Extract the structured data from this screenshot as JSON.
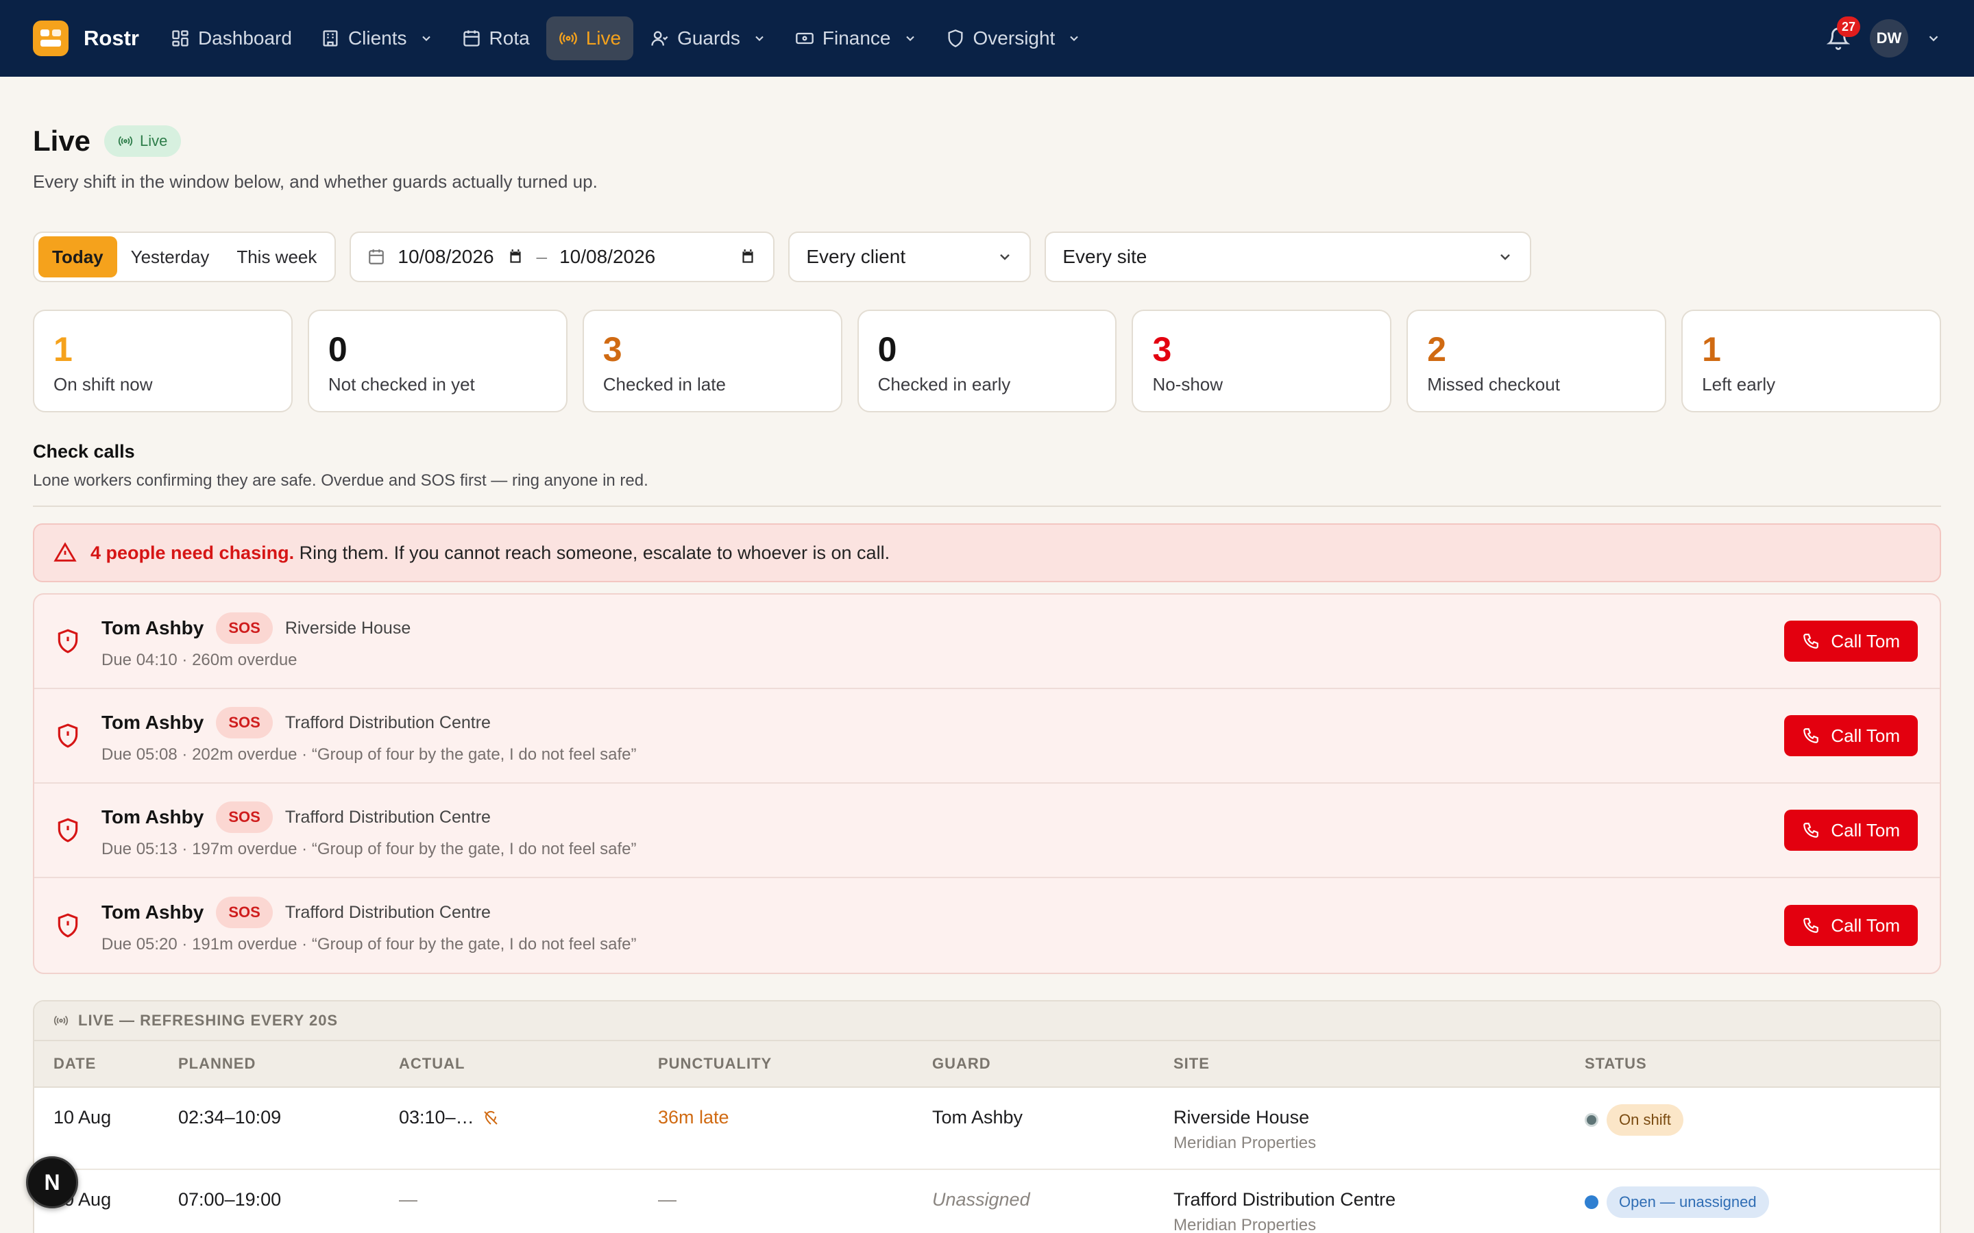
{
  "nav": {
    "brand": "Rostr",
    "items": [
      {
        "label": "Dashboard"
      },
      {
        "label": "Clients"
      },
      {
        "label": "Rota"
      },
      {
        "label": "Live"
      },
      {
        "label": "Guards"
      },
      {
        "label": "Finance"
      },
      {
        "label": "Oversight"
      }
    ],
    "notification_count": "27",
    "avatar_initials": "DW"
  },
  "header": {
    "title": "Live",
    "live_badge": "Live",
    "subtitle": "Every shift in the window below, and whether guards actually turned up."
  },
  "filters": {
    "ranges": [
      "Today",
      "Yesterday",
      "This week"
    ],
    "date_from": "10/08/2026",
    "date_to": "10/08/2026",
    "client": "Every client",
    "site": "Every site"
  },
  "stats": [
    {
      "value": "1",
      "label": "On shift now",
      "color": "#f5a21c"
    },
    {
      "value": "0",
      "label": "Not checked in yet",
      "color": "#141414"
    },
    {
      "value": "3",
      "label": "Checked in late",
      "color": "#d06a12"
    },
    {
      "value": "0",
      "label": "Checked in early",
      "color": "#141414"
    },
    {
      "value": "3",
      "label": "No-show",
      "color": "#e3000f"
    },
    {
      "value": "2",
      "label": "Missed checkout",
      "color": "#d06a12"
    },
    {
      "value": "1",
      "label": "Left early",
      "color": "#d06a12"
    }
  ],
  "check_calls": {
    "title": "Check calls",
    "subtitle": "Lone workers confirming they are safe. Overdue and SOS first — ring anyone in red.",
    "alert_strong": "4 people need chasing.",
    "alert_rest": " Ring them. If you cannot reach someone, escalate to whoever is on call.",
    "rows": [
      {
        "name": "Tom Ashby",
        "tag": "SOS",
        "site": "Riverside House",
        "detail": "Due 04:10 · 260m overdue",
        "button": "Call Tom"
      },
      {
        "name": "Tom Ashby",
        "tag": "SOS",
        "site": "Trafford Distribution Centre",
        "detail": "Due 05:08 · 202m overdue · “Group of four by the gate, I do not feel safe”",
        "button": "Call Tom"
      },
      {
        "name": "Tom Ashby",
        "tag": "SOS",
        "site": "Trafford Distribution Centre",
        "detail": "Due 05:13 · 197m overdue · “Group of four by the gate, I do not feel safe”",
        "button": "Call Tom"
      },
      {
        "name": "Tom Ashby",
        "tag": "SOS",
        "site": "Trafford Distribution Centre",
        "detail": "Due 05:20 · 191m overdue · “Group of four by the gate, I do not feel safe”",
        "button": "Call Tom"
      }
    ]
  },
  "table": {
    "caption": "LIVE — REFRESHING EVERY 20S",
    "headers": [
      "DATE",
      "PLANNED",
      "ACTUAL",
      "PUNCTUALITY",
      "GUARD",
      "SITE",
      "STATUS"
    ],
    "rows": [
      {
        "date": "10 Aug",
        "planned": "02:34–10:09",
        "actual": "03:10–…",
        "punctuality": "36m late",
        "guard": "Tom Ashby",
        "site": "Riverside House",
        "client": "Meridian Properties",
        "status": "On shift"
      },
      {
        "date": "10 Aug",
        "planned": "07:00–19:00",
        "actual": "—",
        "punctuality": "—",
        "guard": "Unassigned",
        "site": "Trafford Distribution Centre",
        "client": "Meridian Properties",
        "status": "Open — unassigned"
      }
    ]
  },
  "fab_label": "N"
}
